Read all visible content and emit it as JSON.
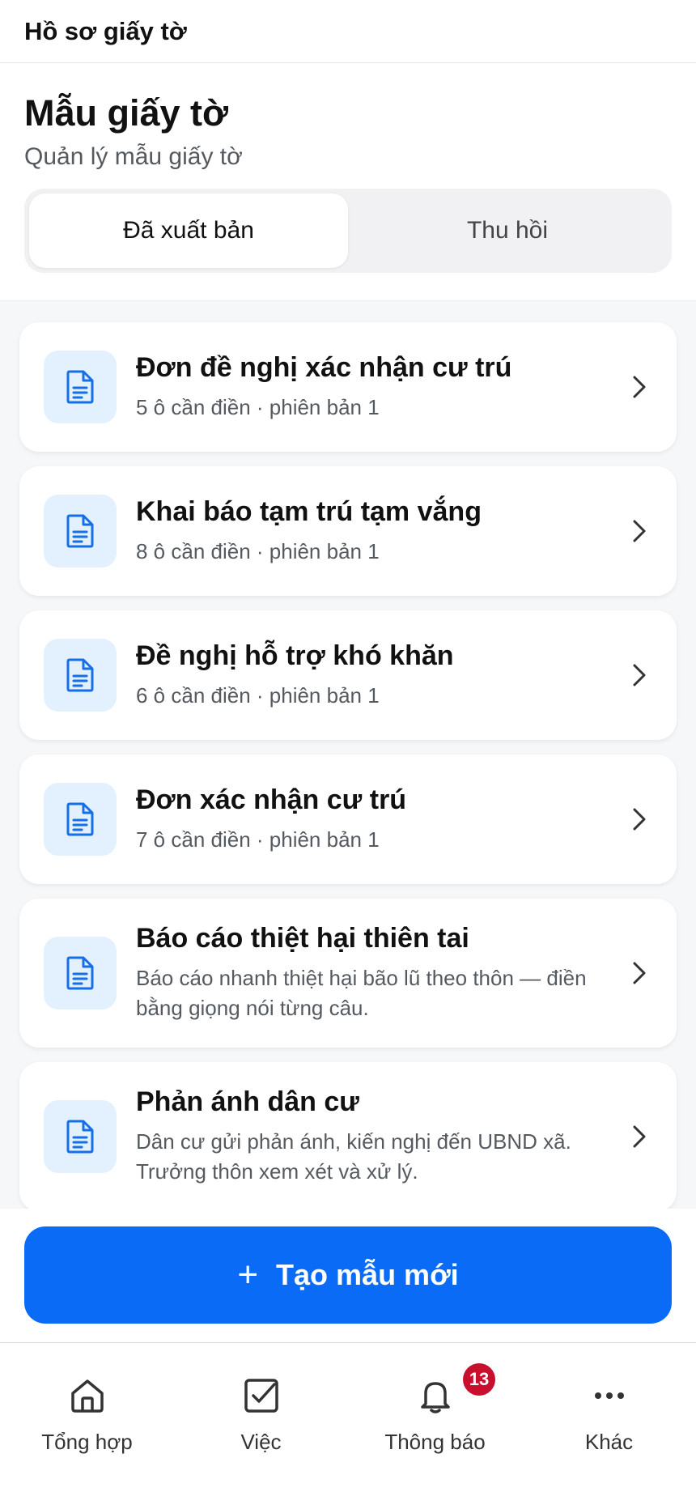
{
  "topbar": {
    "title": "Hồ sơ giấy tờ"
  },
  "header": {
    "title": "Mẫu giấy tờ",
    "subtitle": "Quản lý mẫu giấy tờ"
  },
  "segments": {
    "published": "Đã xuất bản",
    "revoked": "Thu hồi",
    "selected": "Đã xuất bản"
  },
  "templates": [
    {
      "title": "Đơn đề nghị xác nhận cư trú",
      "subtitle": "5 ô cần điền · phiên bản 1",
      "icon": "document-icon"
    },
    {
      "title": "Khai báo tạm trú tạm vắng",
      "subtitle": "8 ô cần điền · phiên bản 1",
      "icon": "document-icon"
    },
    {
      "title": "Đề nghị hỗ trợ khó khăn",
      "subtitle": "6 ô cần điền · phiên bản 1",
      "icon": "document-icon"
    },
    {
      "title": "Đơn xác nhận cư trú",
      "subtitle": "7 ô cần điền · phiên bản 1",
      "icon": "document-icon"
    },
    {
      "title": "Báo cáo thiệt hại thiên tai",
      "subtitle": "Báo cáo nhanh thiệt hại bão lũ theo thôn — điền bằng giọng nói từng câu.",
      "icon": "document-icon"
    },
    {
      "title": "Phản ánh dân cư",
      "subtitle": "Dân cư gửi phản ánh, kiến nghị đến UBND xã. Trưởng thôn xem xét và xử lý.",
      "icon": "document-icon"
    }
  ],
  "actions": {
    "plus": "+",
    "create_label": "Tạo mẫu mới"
  },
  "tabbar": {
    "items": [
      {
        "label": "Tổng hợp",
        "icon": "home-icon"
      },
      {
        "label": "Việc",
        "icon": "checkbox-icon"
      },
      {
        "label": "Thông báo",
        "icon": "bell-icon",
        "badge": "13"
      },
      {
        "label": "Khác",
        "icon": "more-icon"
      }
    ]
  },
  "colors": {
    "accent": "#0a6cf6",
    "icon_bg": "#e3f0fd",
    "badge": "#c8102e",
    "list_bg": "#f6f7f9"
  }
}
